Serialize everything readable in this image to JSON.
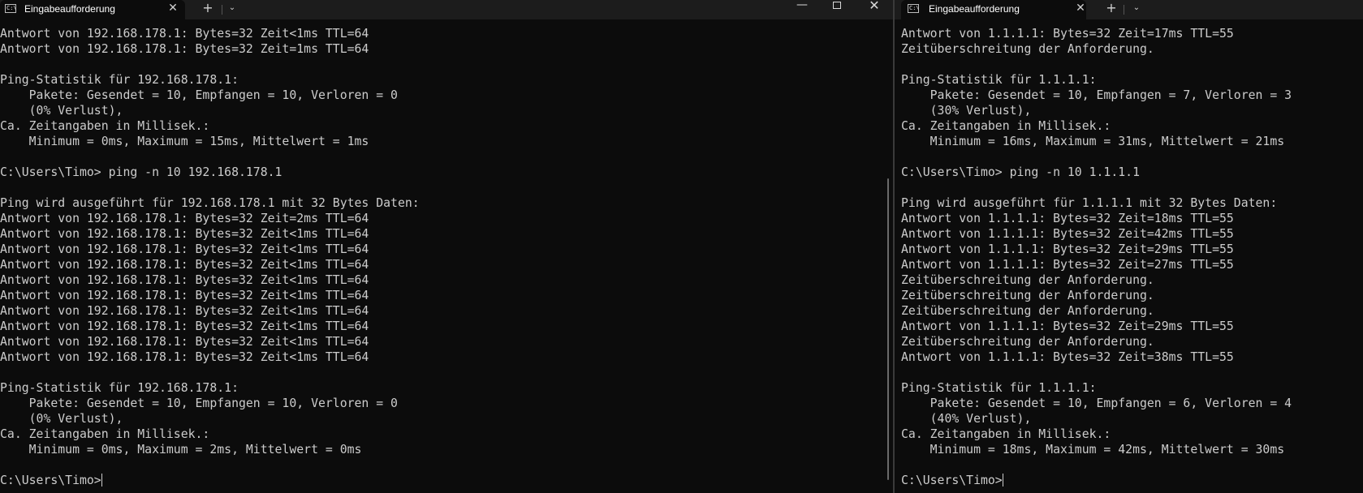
{
  "left_window": {
    "tab": {
      "icon_text": "C:\\",
      "title": "Eingabeaufforderung",
      "close_glyph": "✕"
    },
    "new_tab_glyph": "+",
    "dropdown_glyph": "⌄",
    "controls": {
      "minimize_glyph": "—",
      "close_glyph": "✕"
    },
    "lines": [
      "Antwort von 192.168.178.1: Bytes=32 Zeit<1ms TTL=64",
      "Antwort von 192.168.178.1: Bytes=32 Zeit=1ms TTL=64",
      "",
      "Ping-Statistik für 192.168.178.1:",
      "    Pakete: Gesendet = 10, Empfangen = 10, Verloren = 0",
      "    (0% Verlust),",
      "Ca. Zeitangaben in Millisek.:",
      "    Minimum = 0ms, Maximum = 15ms, Mittelwert = 1ms",
      "",
      "C:\\Users\\Timo> ping -n 10 192.168.178.1",
      "",
      "Ping wird ausgeführt für 192.168.178.1 mit 32 Bytes Daten:",
      "Antwort von 192.168.178.1: Bytes=32 Zeit=2ms TTL=64",
      "Antwort von 192.168.178.1: Bytes=32 Zeit<1ms TTL=64",
      "Antwort von 192.168.178.1: Bytes=32 Zeit<1ms TTL=64",
      "Antwort von 192.168.178.1: Bytes=32 Zeit<1ms TTL=64",
      "Antwort von 192.168.178.1: Bytes=32 Zeit<1ms TTL=64",
      "Antwort von 192.168.178.1: Bytes=32 Zeit<1ms TTL=64",
      "Antwort von 192.168.178.1: Bytes=32 Zeit<1ms TTL=64",
      "Antwort von 192.168.178.1: Bytes=32 Zeit<1ms TTL=64",
      "Antwort von 192.168.178.1: Bytes=32 Zeit<1ms TTL=64",
      "Antwort von 192.168.178.1: Bytes=32 Zeit<1ms TTL=64",
      "",
      "Ping-Statistik für 192.168.178.1:",
      "    Pakete: Gesendet = 10, Empfangen = 10, Verloren = 0",
      "    (0% Verlust),",
      "Ca. Zeitangaben in Millisek.:",
      "    Minimum = 0ms, Maximum = 2ms, Mittelwert = 0ms",
      ""
    ],
    "prompt": "C:\\Users\\Timo>"
  },
  "right_window": {
    "tab": {
      "icon_text": "C:\\",
      "title": "Eingabeaufforderung",
      "close_glyph": "✕"
    },
    "new_tab_glyph": "+",
    "dropdown_glyph": "⌄",
    "lines": [
      "Antwort von 1.1.1.1: Bytes=32 Zeit=17ms TTL=55",
      "Zeitüberschreitung der Anforderung.",
      "",
      "Ping-Statistik für 1.1.1.1:",
      "    Pakete: Gesendet = 10, Empfangen = 7, Verloren = 3",
      "    (30% Verlust),",
      "Ca. Zeitangaben in Millisek.:",
      "    Minimum = 16ms, Maximum = 31ms, Mittelwert = 21ms",
      "",
      "C:\\Users\\Timo> ping -n 10 1.1.1.1",
      "",
      "Ping wird ausgeführt für 1.1.1.1 mit 32 Bytes Daten:",
      "Antwort von 1.1.1.1: Bytes=32 Zeit=18ms TTL=55",
      "Antwort von 1.1.1.1: Bytes=32 Zeit=42ms TTL=55",
      "Antwort von 1.1.1.1: Bytes=32 Zeit=29ms TTL=55",
      "Antwort von 1.1.1.1: Bytes=32 Zeit=27ms TTL=55",
      "Zeitüberschreitung der Anforderung.",
      "Zeitüberschreitung der Anforderung.",
      "Zeitüberschreitung der Anforderung.",
      "Antwort von 1.1.1.1: Bytes=32 Zeit=29ms TTL=55",
      "Zeitüberschreitung der Anforderung.",
      "Antwort von 1.1.1.1: Bytes=32 Zeit=38ms TTL=55",
      "",
      "Ping-Statistik für 1.1.1.1:",
      "    Pakete: Gesendet = 10, Empfangen = 6, Verloren = 4",
      "    (40% Verlust),",
      "Ca. Zeitangaben in Millisek.:",
      "    Minimum = 18ms, Maximum = 42ms, Mittelwert = 30ms",
      ""
    ],
    "prompt": "C:\\Users\\Timo>"
  },
  "colors": {
    "background": "#0c0c0c",
    "titlebar": "#1c1c1c",
    "text": "#cccccc"
  }
}
